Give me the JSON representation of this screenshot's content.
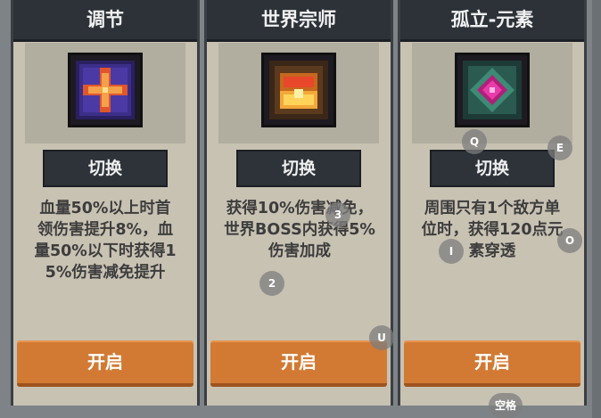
{
  "cards": [
    {
      "title": "调节",
      "switch_label": "切换",
      "description": "血量50%以上时首\n领伤害提升8%，血\n量50%以下时获得1\n5%伤害减免提升",
      "open_label": "开启",
      "icon": "cross-rune-icon"
    },
    {
      "title": "世界宗师",
      "switch_label": "切换",
      "description": "获得10%伤害减免，\n世界BOSS内获得5%\n伤害加成",
      "open_label": "开启",
      "icon": "treasure-chest-icon"
    },
    {
      "title": "孤立-元素",
      "switch_label": "切换",
      "description": "周围只有1个敌方单\n位时，获得120点元\n素穿透",
      "open_label": "开启",
      "icon": "element-gem-icon"
    }
  ],
  "key_hints": [
    "Q",
    "E",
    "3",
    "I",
    "O",
    "2",
    "U",
    "空格"
  ],
  "colors": {
    "header": "#2c3238",
    "card": "#c8c2b3",
    "open_button": "#d27a33",
    "text": "#3d3d3d"
  }
}
